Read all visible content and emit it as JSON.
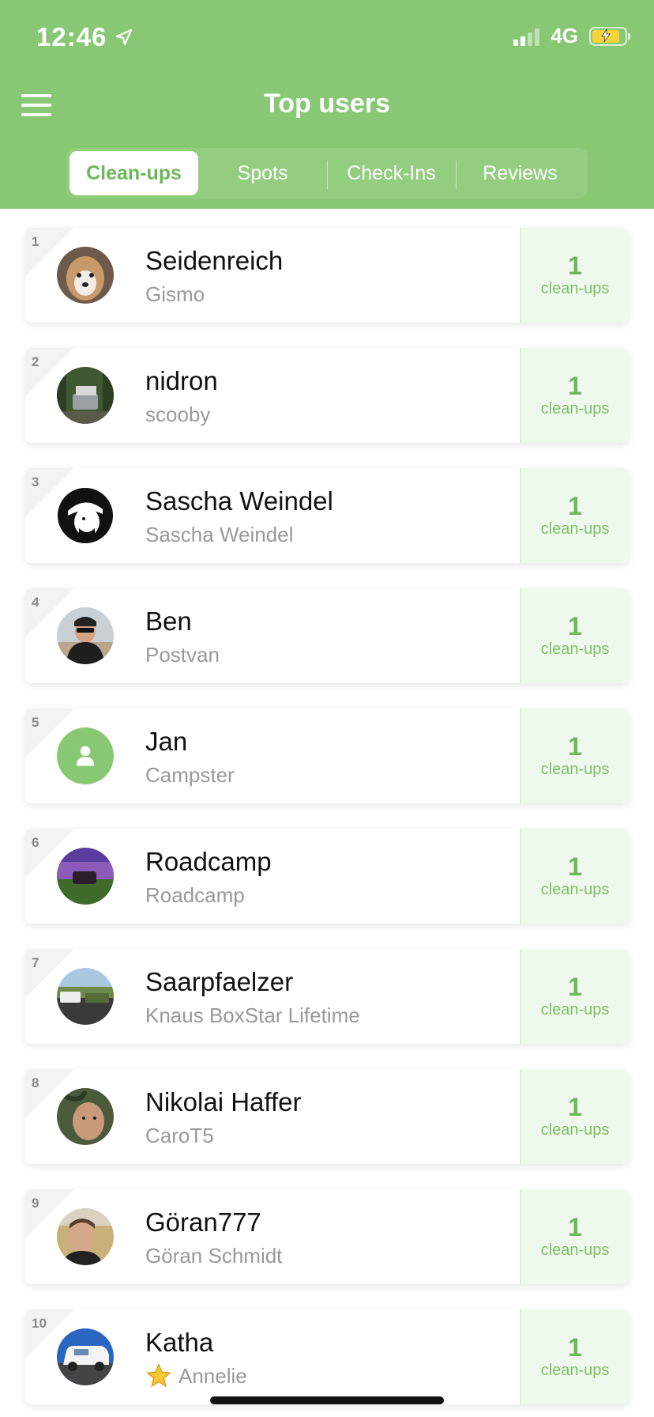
{
  "status": {
    "time": "12:46",
    "network": "4G"
  },
  "header": {
    "title": "Top users"
  },
  "tabs": [
    {
      "label": "Clean-ups",
      "active": true
    },
    {
      "label": "Spots",
      "active": false
    },
    {
      "label": "Check-Ins",
      "active": false
    },
    {
      "label": "Reviews",
      "active": false
    }
  ],
  "users": [
    {
      "rank": "1",
      "name": "Seidenreich",
      "sub": "Gismo",
      "count": "1",
      "unit": "clean-ups"
    },
    {
      "rank": "2",
      "name": "nidron",
      "sub": "scooby",
      "count": "1",
      "unit": "clean-ups"
    },
    {
      "rank": "3",
      "name": "Sascha Weindel",
      "sub": "Sascha Weindel",
      "count": "1",
      "unit": "clean-ups"
    },
    {
      "rank": "4",
      "name": "Ben",
      "sub": "Postvan",
      "count": "1",
      "unit": "clean-ups"
    },
    {
      "rank": "5",
      "name": "Jan",
      "sub": "Campster",
      "count": "1",
      "unit": "clean-ups"
    },
    {
      "rank": "6",
      "name": "Roadcamp",
      "sub": "Roadcamp",
      "count": "1",
      "unit": "clean-ups"
    },
    {
      "rank": "7",
      "name": "Saarpfaelzer",
      "sub": "Knaus BoxStar Lifetime",
      "count": "1",
      "unit": "clean-ups"
    },
    {
      "rank": "8",
      "name": "Nikolai Haffer",
      "sub": "CaroT5",
      "count": "1",
      "unit": "clean-ups"
    },
    {
      "rank": "9",
      "name": "Göran777",
      "sub": "Göran Schmidt",
      "count": "1",
      "unit": "clean-ups"
    },
    {
      "rank": "10",
      "name": "Katha",
      "sub": "Annelie",
      "count": "1",
      "unit": "clean-ups"
    }
  ],
  "colors": {
    "brand": "#88c874",
    "accent": "#6cb858",
    "score_bg": "#eff8ec"
  }
}
